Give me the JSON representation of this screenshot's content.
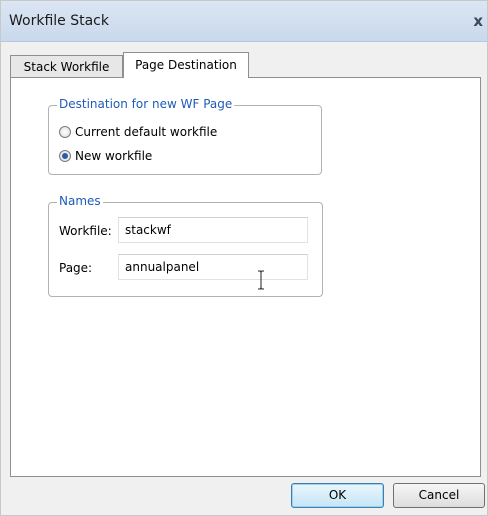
{
  "window": {
    "title": "Workfile Stack",
    "close_glyph": "x"
  },
  "tabs": [
    {
      "label": "Stack Workfile",
      "selected": false
    },
    {
      "label": "Page Destination",
      "selected": true
    }
  ],
  "destination_group": {
    "legend": "Destination for new WF Page",
    "options": [
      {
        "label": "Current default workfile",
        "checked": false
      },
      {
        "label": "New workfile",
        "checked": true
      }
    ]
  },
  "names_group": {
    "legend": "Names",
    "workfile_label": "Workfile:",
    "workfile_value": "stackwf",
    "page_label": "Page:",
    "page_value": "annualpanel"
  },
  "buttons": {
    "ok_label": "OK",
    "cancel_label": "Cancel"
  },
  "colors": {
    "legend_text": "#1f5bb8",
    "titlebar": "#c9d8ec"
  },
  "icons": {
    "close": "close-icon",
    "radio": "radio-button-icon",
    "text_cursor": "i-beam-cursor-icon"
  }
}
